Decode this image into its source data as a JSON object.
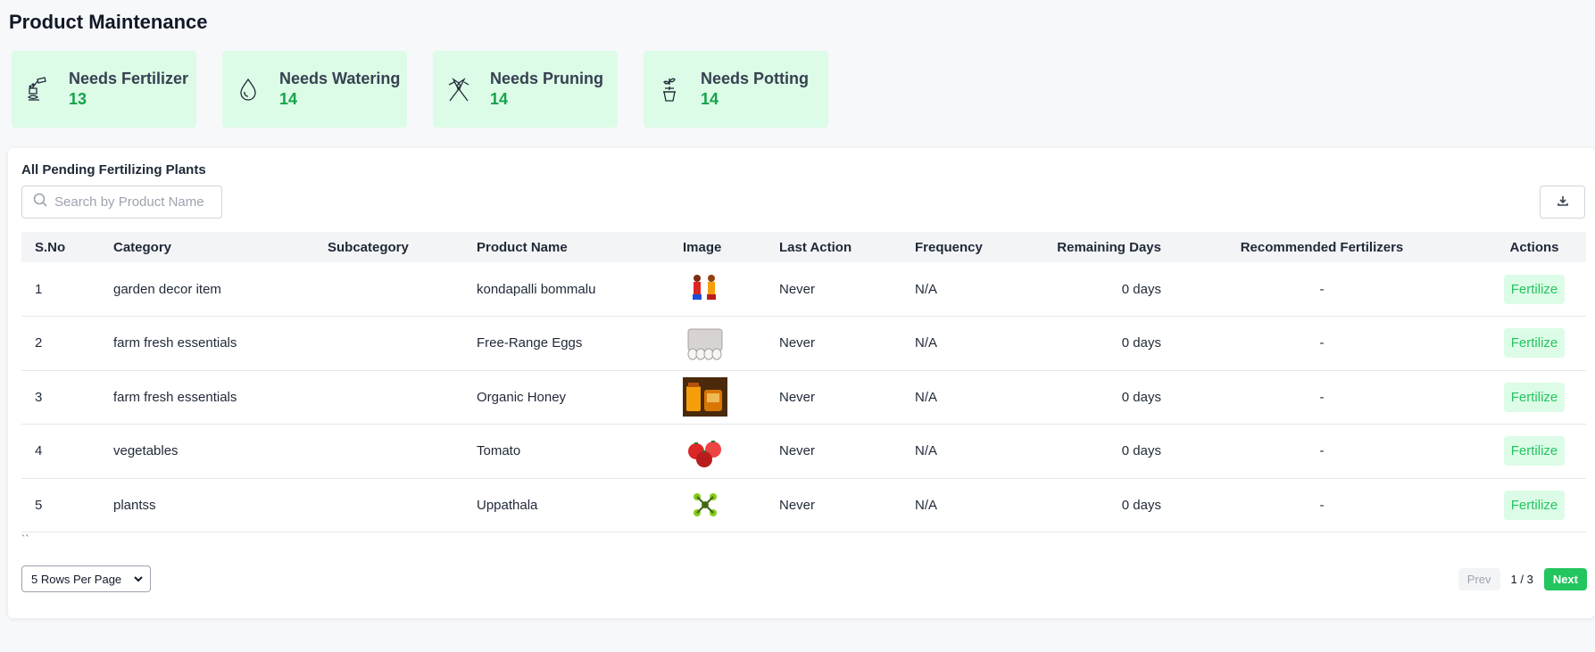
{
  "page": {
    "title": "Product Maintenance"
  },
  "cards": [
    {
      "label": "Needs Fertilizer",
      "count": "13",
      "icon": "fertilizer-icon"
    },
    {
      "label": "Needs Watering",
      "count": "14",
      "icon": "water-drop-icon"
    },
    {
      "label": "Needs Pruning",
      "count": "14",
      "icon": "pruning-shears-icon"
    },
    {
      "label": "Needs Potting",
      "count": "14",
      "icon": "potting-plant-icon"
    }
  ],
  "panel": {
    "title": "All Pending Fertilizing Plants",
    "search_placeholder": "Search by Product Name",
    "download_icon": "download-icon"
  },
  "table": {
    "headers": {
      "sno": "S.No",
      "category": "Category",
      "subcategory": "Subcategory",
      "product_name": "Product Name",
      "image": "Image",
      "last_action": "Last Action",
      "frequency": "Frequency",
      "remaining_days": "Remaining Days",
      "recommended": "Recommended Fertilizers",
      "actions": "Actions"
    },
    "rows": [
      {
        "sno": "1",
        "category": "garden decor item",
        "subcategory": "",
        "product_name": "kondapalli bommalu",
        "last_action": "Never",
        "frequency": "N/A",
        "remaining_days": "0 days",
        "recommended": "-",
        "action": "Fertilize"
      },
      {
        "sno": "2",
        "category": "farm fresh essentials",
        "subcategory": "",
        "product_name": "Free-Range Eggs",
        "last_action": "Never",
        "frequency": "N/A",
        "remaining_days": "0 days",
        "recommended": "-",
        "action": "Fertilize"
      },
      {
        "sno": "3",
        "category": "farm fresh essentials",
        "subcategory": "",
        "product_name": "Organic Honey",
        "last_action": "Never",
        "frequency": "N/A",
        "remaining_days": "0 days",
        "recommended": "-",
        "action": "Fertilize"
      },
      {
        "sno": "4",
        "category": "vegetables",
        "subcategory": "",
        "product_name": "Tomato",
        "last_action": "Never",
        "frequency": "N/A",
        "remaining_days": "0 days",
        "recommended": "-",
        "action": "Fertilize"
      },
      {
        "sno": "5",
        "category": "plantss",
        "subcategory": "",
        "product_name": "Uppathala",
        "last_action": "Never",
        "frequency": "N/A",
        "remaining_days": "0 days",
        "recommended": "-",
        "action": "Fertilize"
      }
    ],
    "trailing_text": "``"
  },
  "pagination": {
    "rows_per_page": "5 Rows Per Page",
    "prev": "Prev",
    "page_indicator": "1 / 3",
    "next": "Next"
  },
  "colors": {
    "card_bg": "#dcfce7",
    "accent_green": "#22c55e",
    "count_green": "#16a34a"
  }
}
